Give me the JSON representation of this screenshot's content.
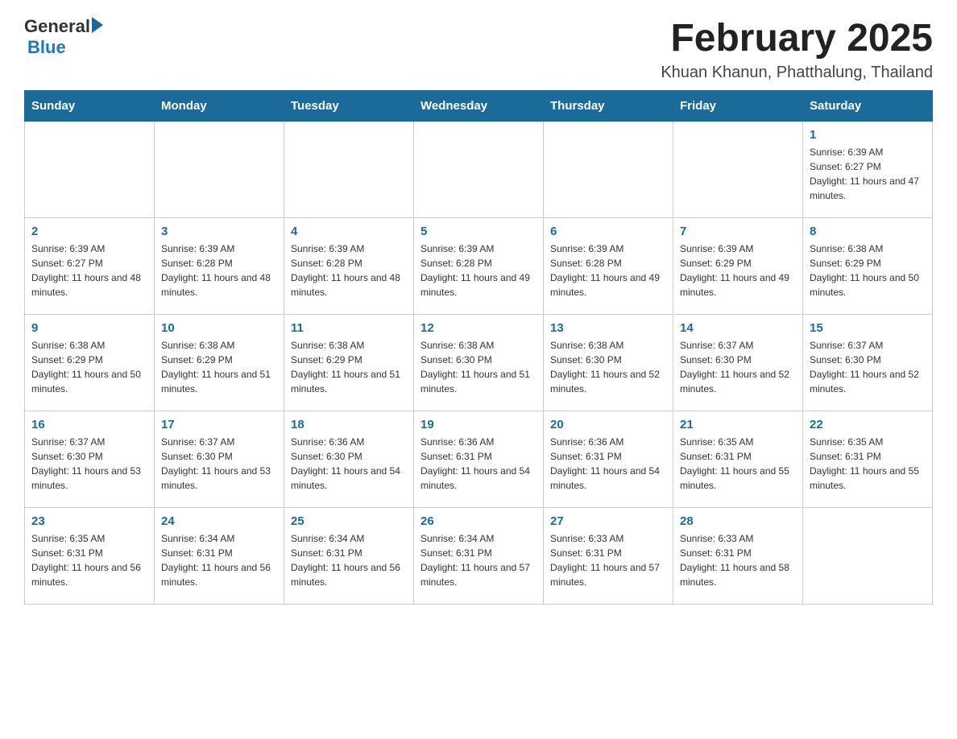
{
  "header": {
    "logo_general": "General",
    "logo_blue": "Blue",
    "month_year": "February 2025",
    "location": "Khuan Khanun, Phatthalung, Thailand"
  },
  "days_of_week": [
    "Sunday",
    "Monday",
    "Tuesday",
    "Wednesday",
    "Thursday",
    "Friday",
    "Saturday"
  ],
  "weeks": [
    [
      {
        "day": "",
        "info": ""
      },
      {
        "day": "",
        "info": ""
      },
      {
        "day": "",
        "info": ""
      },
      {
        "day": "",
        "info": ""
      },
      {
        "day": "",
        "info": ""
      },
      {
        "day": "",
        "info": ""
      },
      {
        "day": "1",
        "info": "Sunrise: 6:39 AM\nSunset: 6:27 PM\nDaylight: 11 hours and 47 minutes."
      }
    ],
    [
      {
        "day": "2",
        "info": "Sunrise: 6:39 AM\nSunset: 6:27 PM\nDaylight: 11 hours and 48 minutes."
      },
      {
        "day": "3",
        "info": "Sunrise: 6:39 AM\nSunset: 6:28 PM\nDaylight: 11 hours and 48 minutes."
      },
      {
        "day": "4",
        "info": "Sunrise: 6:39 AM\nSunset: 6:28 PM\nDaylight: 11 hours and 48 minutes."
      },
      {
        "day": "5",
        "info": "Sunrise: 6:39 AM\nSunset: 6:28 PM\nDaylight: 11 hours and 49 minutes."
      },
      {
        "day": "6",
        "info": "Sunrise: 6:39 AM\nSunset: 6:28 PM\nDaylight: 11 hours and 49 minutes."
      },
      {
        "day": "7",
        "info": "Sunrise: 6:39 AM\nSunset: 6:29 PM\nDaylight: 11 hours and 49 minutes."
      },
      {
        "day": "8",
        "info": "Sunrise: 6:38 AM\nSunset: 6:29 PM\nDaylight: 11 hours and 50 minutes."
      }
    ],
    [
      {
        "day": "9",
        "info": "Sunrise: 6:38 AM\nSunset: 6:29 PM\nDaylight: 11 hours and 50 minutes."
      },
      {
        "day": "10",
        "info": "Sunrise: 6:38 AM\nSunset: 6:29 PM\nDaylight: 11 hours and 51 minutes."
      },
      {
        "day": "11",
        "info": "Sunrise: 6:38 AM\nSunset: 6:29 PM\nDaylight: 11 hours and 51 minutes."
      },
      {
        "day": "12",
        "info": "Sunrise: 6:38 AM\nSunset: 6:30 PM\nDaylight: 11 hours and 51 minutes."
      },
      {
        "day": "13",
        "info": "Sunrise: 6:38 AM\nSunset: 6:30 PM\nDaylight: 11 hours and 52 minutes."
      },
      {
        "day": "14",
        "info": "Sunrise: 6:37 AM\nSunset: 6:30 PM\nDaylight: 11 hours and 52 minutes."
      },
      {
        "day": "15",
        "info": "Sunrise: 6:37 AM\nSunset: 6:30 PM\nDaylight: 11 hours and 52 minutes."
      }
    ],
    [
      {
        "day": "16",
        "info": "Sunrise: 6:37 AM\nSunset: 6:30 PM\nDaylight: 11 hours and 53 minutes."
      },
      {
        "day": "17",
        "info": "Sunrise: 6:37 AM\nSunset: 6:30 PM\nDaylight: 11 hours and 53 minutes."
      },
      {
        "day": "18",
        "info": "Sunrise: 6:36 AM\nSunset: 6:30 PM\nDaylight: 11 hours and 54 minutes."
      },
      {
        "day": "19",
        "info": "Sunrise: 6:36 AM\nSunset: 6:31 PM\nDaylight: 11 hours and 54 minutes."
      },
      {
        "day": "20",
        "info": "Sunrise: 6:36 AM\nSunset: 6:31 PM\nDaylight: 11 hours and 54 minutes."
      },
      {
        "day": "21",
        "info": "Sunrise: 6:35 AM\nSunset: 6:31 PM\nDaylight: 11 hours and 55 minutes."
      },
      {
        "day": "22",
        "info": "Sunrise: 6:35 AM\nSunset: 6:31 PM\nDaylight: 11 hours and 55 minutes."
      }
    ],
    [
      {
        "day": "23",
        "info": "Sunrise: 6:35 AM\nSunset: 6:31 PM\nDaylight: 11 hours and 56 minutes."
      },
      {
        "day": "24",
        "info": "Sunrise: 6:34 AM\nSunset: 6:31 PM\nDaylight: 11 hours and 56 minutes."
      },
      {
        "day": "25",
        "info": "Sunrise: 6:34 AM\nSunset: 6:31 PM\nDaylight: 11 hours and 56 minutes."
      },
      {
        "day": "26",
        "info": "Sunrise: 6:34 AM\nSunset: 6:31 PM\nDaylight: 11 hours and 57 minutes."
      },
      {
        "day": "27",
        "info": "Sunrise: 6:33 AM\nSunset: 6:31 PM\nDaylight: 11 hours and 57 minutes."
      },
      {
        "day": "28",
        "info": "Sunrise: 6:33 AM\nSunset: 6:31 PM\nDaylight: 11 hours and 58 minutes."
      },
      {
        "day": "",
        "info": ""
      }
    ]
  ]
}
